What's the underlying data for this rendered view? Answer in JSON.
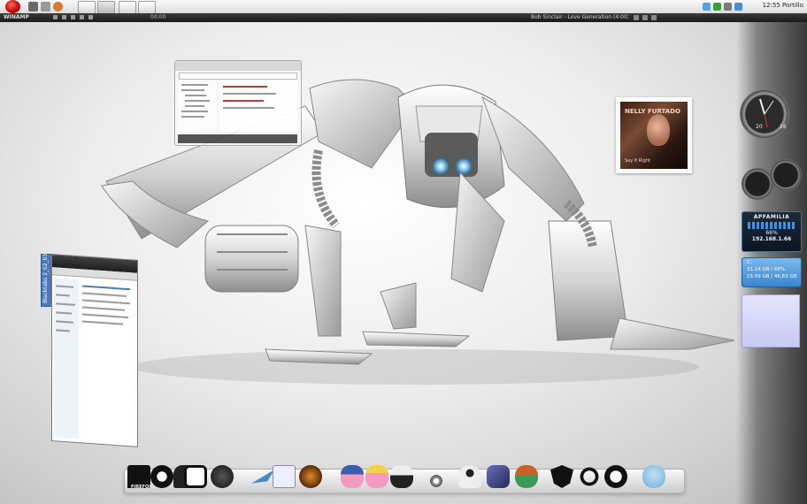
{
  "taskbar": {
    "clock": "12:55 Portillo",
    "quick_launch": [
      "quick-launch-app-1",
      "quick-launch-app-2",
      "quick-launch-app-3"
    ],
    "open_buttons": [
      "taskbar-button-1",
      "taskbar-button-2",
      "taskbar-button-3",
      "taskbar-button-4"
    ]
  },
  "winamp": {
    "logo": "WINAMP",
    "time": "00:00",
    "track": "Bob Sinclair - Love Generation (4:00)"
  },
  "album": {
    "artist": "NELLY FURTADO",
    "subtitle": "Say It Right"
  },
  "gadgets": {
    "clock_numbers": [
      "20",
      "16"
    ],
    "network": {
      "name": "APFAMILIA",
      "percent": "66%",
      "ip": "192.168.1.66"
    },
    "drive": {
      "letter": "C:",
      "line1": "31.14 GB / 68%",
      "line2": "15.09 GB / 46.63 GB"
    }
  },
  "windows": {
    "left_tab": "Blacktabs 2_02_03"
  },
  "dock": {
    "firefox_label": "FIREFOX",
    "items": [
      "firefox-icon",
      "ghost-icon",
      "rooster-icon",
      "app-square-icon",
      "google-earth-icon",
      "jet-icon",
      "dice-icon",
      "game-badge-icon",
      "pink-character-icon",
      "princess-icon",
      "skull-icon",
      "eye-icon",
      "robot-icon",
      "feather-icon",
      "girl-icon",
      "shield-icon",
      "swirl-icon",
      "github-icon",
      "elephant-icon"
    ]
  },
  "colors": {
    "accent": "#3b84cc",
    "start_orb": "#c40000"
  }
}
